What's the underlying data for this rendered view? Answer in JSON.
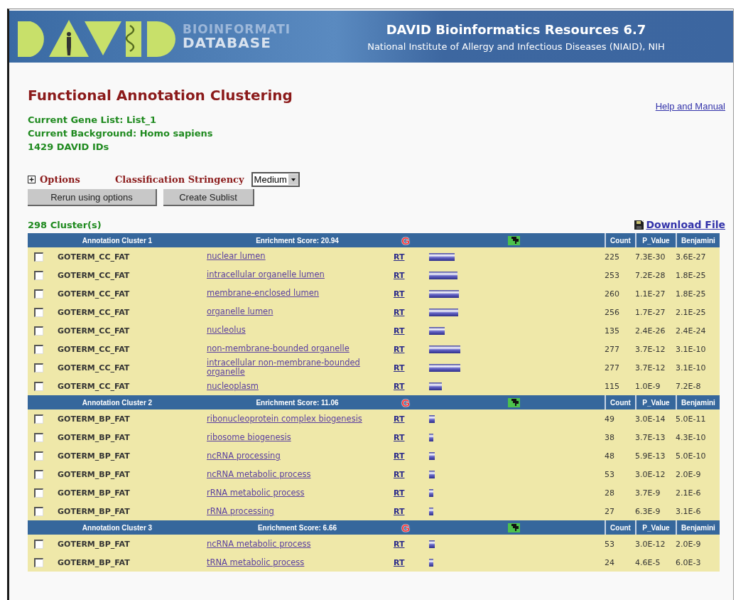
{
  "header": {
    "logo_text": [
      "BIOINFORMATI",
      "DATABASE"
    ],
    "title": "DAVID Bioinformatics Resources 6.7",
    "subtitle": "National Institute of Allergy and Infectious Diseases (NIAID), NIH"
  },
  "page": {
    "title": "Functional Annotation Clustering",
    "help_link": "Help and Manual",
    "info": [
      "Current Gene List: List_1",
      "Current Background: Homo sapiens",
      "1429 DAVID IDs"
    ],
    "options": {
      "label": "Options",
      "expanded": false
    },
    "stringency": {
      "label": "Classification Stringency",
      "value": "Medium"
    },
    "buttons": [
      "Rerun using options",
      "Create Sublist"
    ],
    "cluster_count": "298 Cluster(s)",
    "download_link": "Download File"
  },
  "clusters": [
    {
      "label": "Annotation Cluster 1",
      "score": "Enrichment Score: 20.94",
      "g_link": "G",
      "columns": [
        "Count",
        "P_Value",
        "Benjamini"
      ],
      "rows": [
        {
          "checked": false,
          "category": "GOTERM_CC_FAT",
          "term": "nuclear lumen",
          "rt": "RT",
          "count": "225",
          "p_value": "7.3E-30",
          "benjamini": "3.6E-27"
        },
        {
          "checked": false,
          "category": "GOTERM_CC_FAT",
          "term": "intracellular organelle lumen",
          "rt": "RT",
          "count": "253",
          "p_value": "7.2E-28",
          "benjamini": "1.8E-25"
        },
        {
          "checked": false,
          "category": "GOTERM_CC_FAT",
          "term": "membrane-enclosed lumen",
          "rt": "RT",
          "count": "260",
          "p_value": "1.1E-27",
          "benjamini": "1.8E-25"
        },
        {
          "checked": false,
          "category": "GOTERM_CC_FAT",
          "term": "organelle lumen",
          "rt": "RT",
          "count": "256",
          "p_value": "1.7E-27",
          "benjamini": "2.1E-25"
        },
        {
          "checked": false,
          "category": "GOTERM_CC_FAT",
          "term": "nucleolus",
          "rt": "RT",
          "count": "135",
          "p_value": "2.4E-26",
          "benjamini": "2.4E-24"
        },
        {
          "checked": false,
          "category": "GOTERM_CC_FAT",
          "term": "non-membrane-bounded organelle",
          "rt": "RT",
          "count": "277",
          "p_value": "3.7E-12",
          "benjamini": "3.1E-10"
        },
        {
          "checked": false,
          "category": "GOTERM_CC_FAT",
          "term": "intracellular non-membrane-bounded organelle",
          "rt": "RT",
          "count": "277",
          "p_value": "3.7E-12",
          "benjamini": "3.1E-10"
        },
        {
          "checked": false,
          "category": "GOTERM_CC_FAT",
          "term": "nucleoplasm",
          "rt": "RT",
          "count": "115",
          "p_value": "1.0E-9",
          "benjamini": "7.2E-8"
        }
      ]
    },
    {
      "label": "Annotation Cluster 2",
      "score": "Enrichment Score: 11.06",
      "g_link": "G",
      "columns": [
        "Count",
        "P_Value",
        "Benjamini"
      ],
      "rows": [
        {
          "checked": false,
          "category": "GOTERM_BP_FAT",
          "term": "ribonucleoprotein complex biogenesis",
          "rt": "RT",
          "count": "49",
          "p_value": "3.0E-14",
          "benjamini": "5.0E-11"
        },
        {
          "checked": false,
          "category": "GOTERM_BP_FAT",
          "term": "ribosome biogenesis",
          "rt": "RT",
          "count": "38",
          "p_value": "3.7E-13",
          "benjamini": "4.3E-10"
        },
        {
          "checked": false,
          "category": "GOTERM_BP_FAT",
          "term": "ncRNA processing",
          "rt": "RT",
          "count": "48",
          "p_value": "5.9E-13",
          "benjamini": "5.0E-10"
        },
        {
          "checked": false,
          "category": "GOTERM_BP_FAT",
          "term": "ncRNA metabolic process",
          "rt": "RT",
          "count": "53",
          "p_value": "3.0E-12",
          "benjamini": "2.0E-9"
        },
        {
          "checked": false,
          "category": "GOTERM_BP_FAT",
          "term": "rRNA metabolic process",
          "rt": "RT",
          "count": "28",
          "p_value": "3.7E-9",
          "benjamini": "2.1E-6"
        },
        {
          "checked": false,
          "category": "GOTERM_BP_FAT",
          "term": "rRNA processing",
          "rt": "RT",
          "count": "27",
          "p_value": "6.3E-9",
          "benjamini": "3.1E-6"
        }
      ]
    },
    {
      "label": "Annotation Cluster 3",
      "score": "Enrichment Score: 6.66",
      "g_link": "G",
      "columns": [
        "Count",
        "P_Value",
        "Benjamini"
      ],
      "rows": [
        {
          "checked": false,
          "category": "GOTERM_BP_FAT",
          "term": "ncRNA metabolic process",
          "rt": "RT",
          "count": "53",
          "p_value": "3.0E-12",
          "benjamini": "2.0E-9"
        },
        {
          "checked": false,
          "category": "GOTERM_BP_FAT",
          "term": "tRNA metabolic process",
          "rt": "RT",
          "count": "24",
          "p_value": "4.6E-5",
          "benjamini": "6.0E-3"
        }
      ]
    }
  ]
}
